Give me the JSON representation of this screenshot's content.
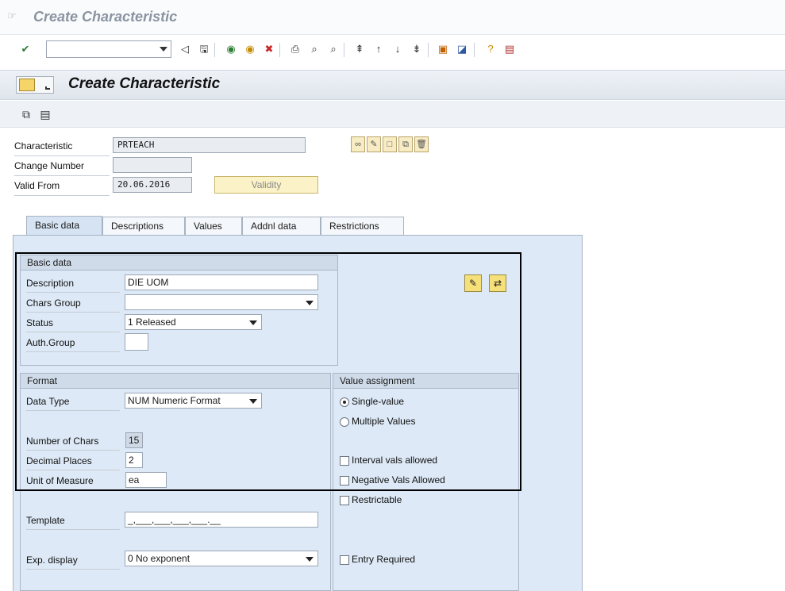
{
  "window": {
    "title": "Create Characteristic"
  },
  "header": {
    "title": "Create Characteristic"
  },
  "fields": {
    "characteristic": {
      "label": "Characteristic",
      "value": "PRTEACH"
    },
    "change_number": {
      "label": "Change Number",
      "value": ""
    },
    "valid_from": {
      "label": "Valid From",
      "value": "20.06.2016"
    },
    "validity_button": "Validity"
  },
  "tabs": [
    {
      "label": "Basic data",
      "active": true
    },
    {
      "label": "Descriptions"
    },
    {
      "label": "Values"
    },
    {
      "label": "Addnl data"
    },
    {
      "label": "Restrictions"
    }
  ],
  "basic_data": {
    "title": "Basic data",
    "description": {
      "label": "Description",
      "value": "DIE UOM"
    },
    "chars_group": {
      "label": "Chars Group",
      "value": ""
    },
    "status": {
      "label": "Status",
      "value": "1 Released"
    },
    "auth_group": {
      "label": "Auth.Group",
      "value": ""
    }
  },
  "format": {
    "title": "Format",
    "data_type": {
      "label": "Data Type",
      "value": "NUM Numeric Format"
    },
    "number_of_chars": {
      "label": "Number of Chars",
      "value": "15"
    },
    "decimal_places": {
      "label": "Decimal Places",
      "value": "2"
    },
    "unit_of_measure": {
      "label": "Unit of Measure",
      "value": "ea"
    },
    "template": {
      "label": "Template",
      "value": "_,___,___,___,___.__"
    },
    "exp_display": {
      "label": "Exp. display",
      "value": "0 No exponent"
    }
  },
  "value_assignment": {
    "title": "Value assignment",
    "single_value": "Single-value",
    "multiple_values": "Multiple Values",
    "interval_vals": "Interval vals allowed",
    "negative_vals": "Negative Vals Allowed",
    "restrictable": "Restrictable",
    "entry_required": "Entry Required"
  },
  "icons": [
    "check-icon",
    "back-icon",
    "save-icon",
    "back-nav-icon",
    "exit-icon",
    "cancel-icon",
    "print-icon",
    "find-icon",
    "find-next-icon",
    "first-page-icon",
    "prev-page-icon",
    "next-page-icon",
    "last-page-icon",
    "new-session-icon",
    "shortcut-icon",
    "help-icon",
    "layout-icon"
  ],
  "colors": {
    "active_tab": "#d5e3f3",
    "panel": "#dde9f6",
    "highlight_border": "#000000"
  }
}
